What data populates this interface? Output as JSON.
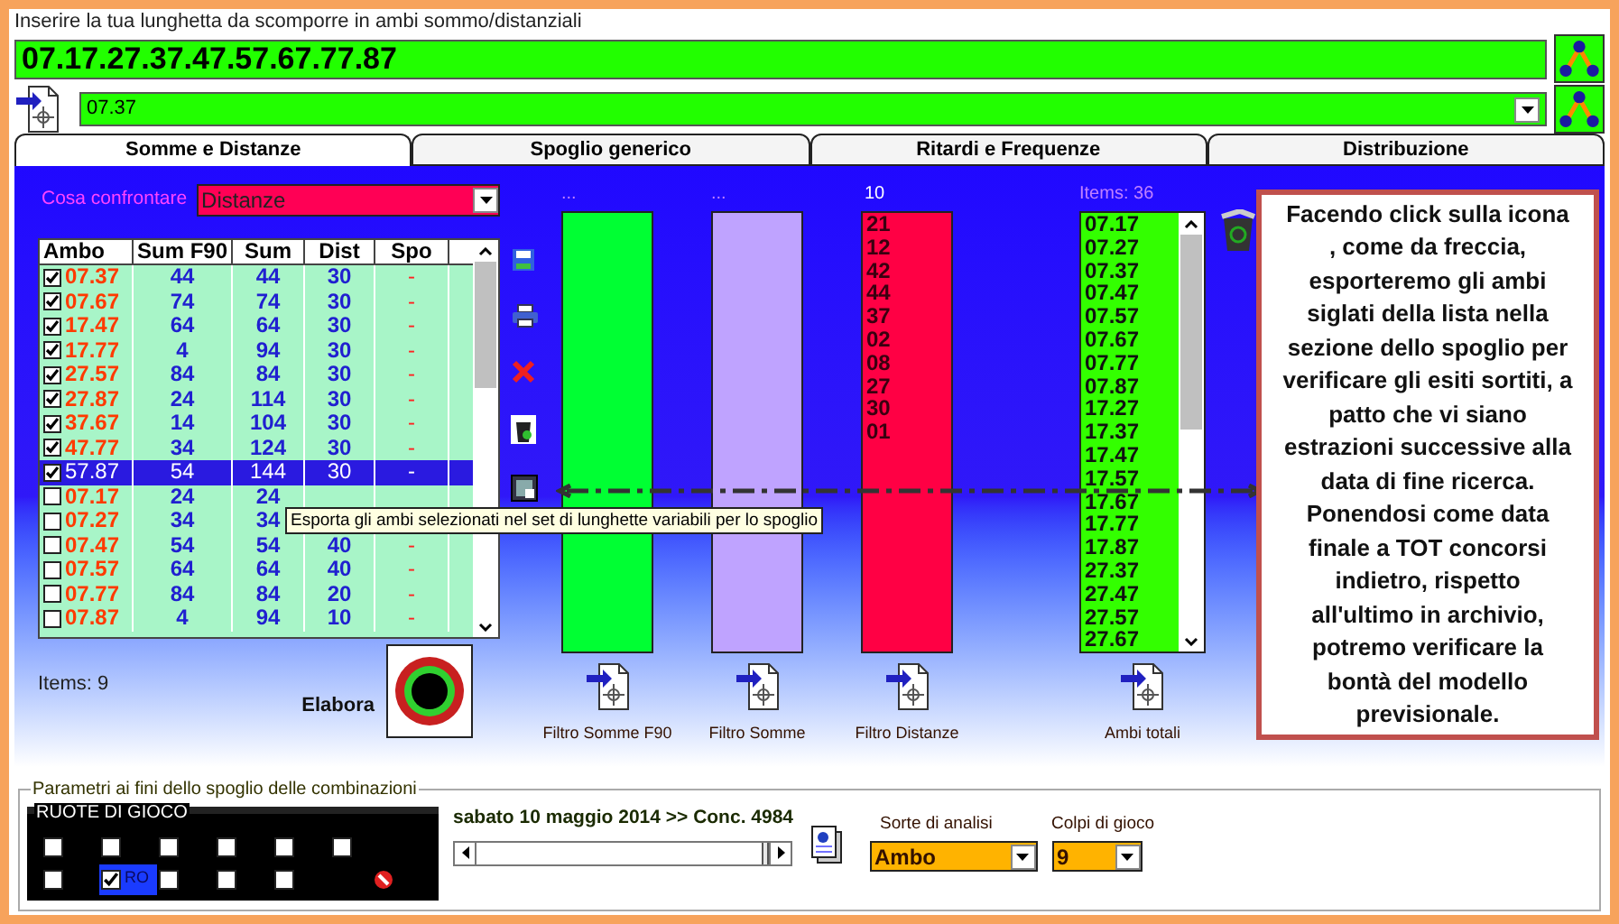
{
  "input_label": "Inserire la tua lunghetta da scomporre in ambi sommo/distanziali",
  "lunghetta": {
    "value": "07.17.27.37.47.57.67.77.87"
  },
  "ambo_combo": {
    "value": "07.37"
  },
  "tabs": [
    {
      "label": "Somme e Distanze",
      "selected": true
    },
    {
      "label": "Spoglio generico",
      "selected": false
    },
    {
      "label": "Ritardi e Frequenze",
      "selected": false
    },
    {
      "label": "Distribuzione",
      "selected": false
    }
  ],
  "compare": {
    "label": "Cosa confrontare",
    "value": "Distanze"
  },
  "table": {
    "columns": [
      "Ambo",
      "Sum F90",
      "Sum",
      "Dist",
      "Spo"
    ],
    "rows": [
      {
        "ambo": "07.37",
        "sum_f90": "44",
        "sum": "44",
        "dist": "30",
        "spo": "-",
        "checked": true,
        "selected": false
      },
      {
        "ambo": "07.67",
        "sum_f90": "74",
        "sum": "74",
        "dist": "30",
        "spo": "-",
        "checked": true,
        "selected": false
      },
      {
        "ambo": "17.47",
        "sum_f90": "64",
        "sum": "64",
        "dist": "30",
        "spo": "-",
        "checked": true,
        "selected": false
      },
      {
        "ambo": "17.77",
        "sum_f90": "4",
        "sum": "94",
        "dist": "30",
        "spo": "-",
        "checked": true,
        "selected": false
      },
      {
        "ambo": "27.57",
        "sum_f90": "84",
        "sum": "84",
        "dist": "30",
        "spo": "-",
        "checked": true,
        "selected": false
      },
      {
        "ambo": "27.87",
        "sum_f90": "24",
        "sum": "114",
        "dist": "30",
        "spo": "-",
        "checked": true,
        "selected": false
      },
      {
        "ambo": "37.67",
        "sum_f90": "14",
        "sum": "104",
        "dist": "30",
        "spo": "-",
        "checked": true,
        "selected": false
      },
      {
        "ambo": "47.77",
        "sum_f90": "34",
        "sum": "124",
        "dist": "30",
        "spo": "-",
        "checked": true,
        "selected": false
      },
      {
        "ambo": "57.87",
        "sum_f90": "54",
        "sum": "144",
        "dist": "30",
        "spo": "-",
        "checked": true,
        "selected": true
      },
      {
        "ambo": "07.17",
        "sum_f90": "24",
        "sum": "24",
        "checked": false,
        "selected": false
      },
      {
        "ambo": "07.27",
        "sum_f90": "34",
        "sum": "34",
        "checked": false,
        "selected": false
      },
      {
        "ambo": "07.47",
        "sum_f90": "54",
        "sum": "54",
        "dist": "40",
        "spo": "-",
        "checked": false,
        "selected": false
      },
      {
        "ambo": "07.57",
        "sum_f90": "64",
        "sum": "64",
        "dist": "40",
        "spo": "-",
        "checked": false,
        "selected": false
      },
      {
        "ambo": "07.77",
        "sum_f90": "84",
        "sum": "84",
        "dist": "20",
        "spo": "-",
        "checked": false,
        "selected": false
      },
      {
        "ambo": "07.87",
        "sum_f90": "4",
        "sum": "94",
        "dist": "10",
        "spo": "-",
        "checked": false,
        "selected": false
      }
    ]
  },
  "tooltip": "Esporta gli ambi selezionati nel set di lunghette variabili per lo spoglio",
  "items_count": "Items: 9",
  "elabora": "Elabora",
  "lists": [
    {
      "kind": "filter",
      "header": "...",
      "color": "#00ff33",
      "label": "Filtro Somme F90"
    },
    {
      "kind": "filter",
      "header": "...",
      "color": "#bfa3ff",
      "label": "Filtro Somme"
    },
    {
      "kind": "filter",
      "header": "10",
      "color": "#ff0044",
      "label": "Filtro Distanze",
      "values": [
        "21",
        "12",
        "42",
        "44",
        "37",
        "02",
        "08",
        "27",
        "30",
        "01"
      ]
    },
    {
      "kind": "scroll",
      "header": "Items: 36",
      "color": "#33ff00",
      "label": "Ambi totali",
      "values": [
        "07.17",
        "07.27",
        "07.37",
        "07.47",
        "07.57",
        "07.67",
        "07.77",
        "07.87",
        "17.27",
        "17.37",
        "17.47",
        "17.57",
        "17.67",
        "17.77",
        "17.87",
        "27.37",
        "27.47",
        "27.57",
        "27.67"
      ]
    }
  ],
  "callout": "Facendo click sulla icona , come da freccia, esporteremo gli ambi siglati della lista nella sezione dello spoglio per verificare gli esiti sortiti, a patto che vi siano estrazioni successive alla data di fine ricerca. Ponendosi come data finale a TOT concorsi indietro, rispetto all'ultimo in archivio, potremo verificare la bontà del modello previsionale.",
  "params": {
    "legend": "Parametri ai fini dello spoglio delle combinazioni",
    "ruote": {
      "legend": "RUOTE DI GIOCO",
      "rows": [
        [
          {
            "checked": false
          },
          {
            "checked": false
          },
          {
            "checked": false
          },
          {
            "checked": false
          },
          {
            "checked": false
          },
          {
            "checked": false
          }
        ],
        [
          {
            "checked": false
          },
          {
            "checked": true,
            "label": "RO"
          },
          {
            "checked": false
          },
          {
            "checked": false
          },
          {
            "checked": false
          }
        ]
      ]
    },
    "date": "sabato 10 maggio 2014 >> Conc. 4984",
    "slider": {
      "level": 1
    },
    "sorte": {
      "label": "Sorte di analisi",
      "value": "Ambo"
    },
    "colpi": {
      "label": "Colpi di gioco",
      "value": "9"
    }
  }
}
